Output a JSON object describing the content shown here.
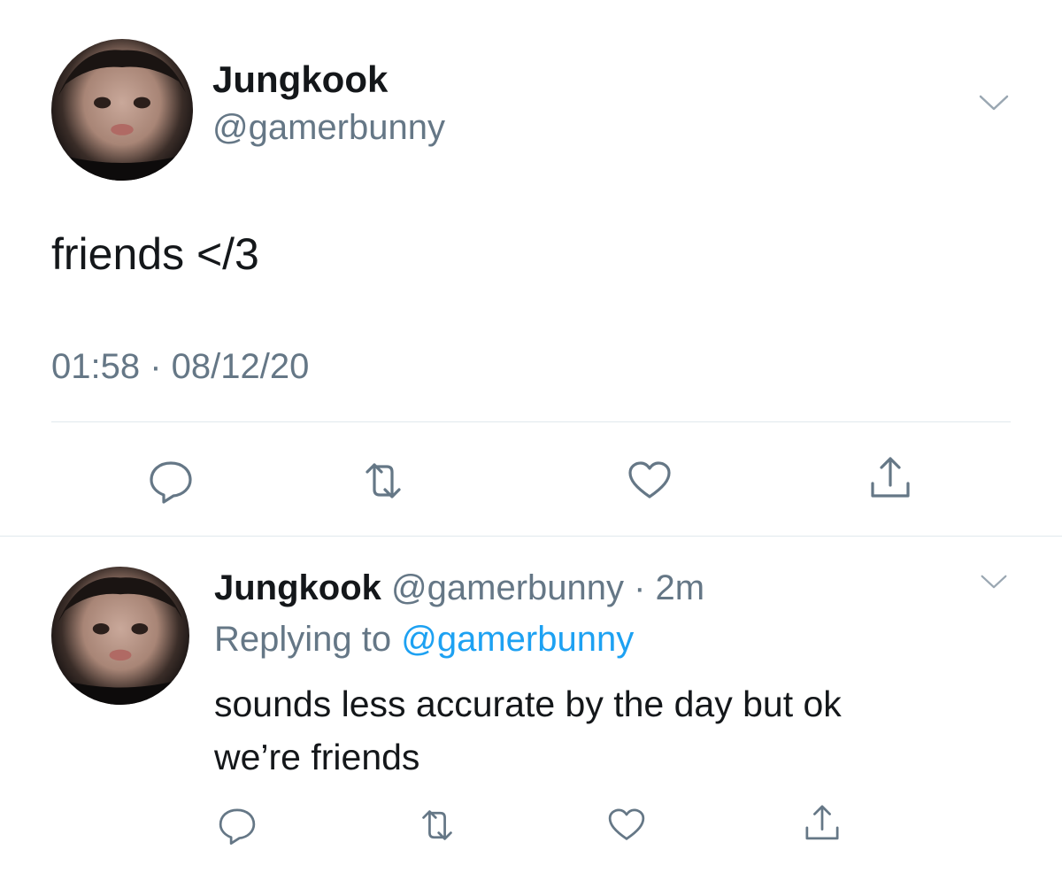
{
  "main_tweet": {
    "display_name": "Jungkook",
    "handle": "@gamerbunny",
    "text": "friends </3",
    "timestamp": "01:58 · 08/12/20",
    "actions": [
      "reply-icon",
      "retweet-icon",
      "like-icon",
      "share-icon"
    ]
  },
  "reply_tweet": {
    "display_name": "Jungkook",
    "handle": "@gamerbunny",
    "age": "· 2m",
    "replying_prefix": "Replying to",
    "replying_handle": "@gamerbunny",
    "text_line1": "sounds less accurate by the day but ok",
    "text_line2": "we’re friends",
    "actions": [
      "reply-icon",
      "retweet-icon",
      "like-icon",
      "share-icon"
    ]
  },
  "colors": {
    "text": "#14171a",
    "muted": "#657786",
    "link": "#1da1f2",
    "divider": "#e1e8ed"
  }
}
